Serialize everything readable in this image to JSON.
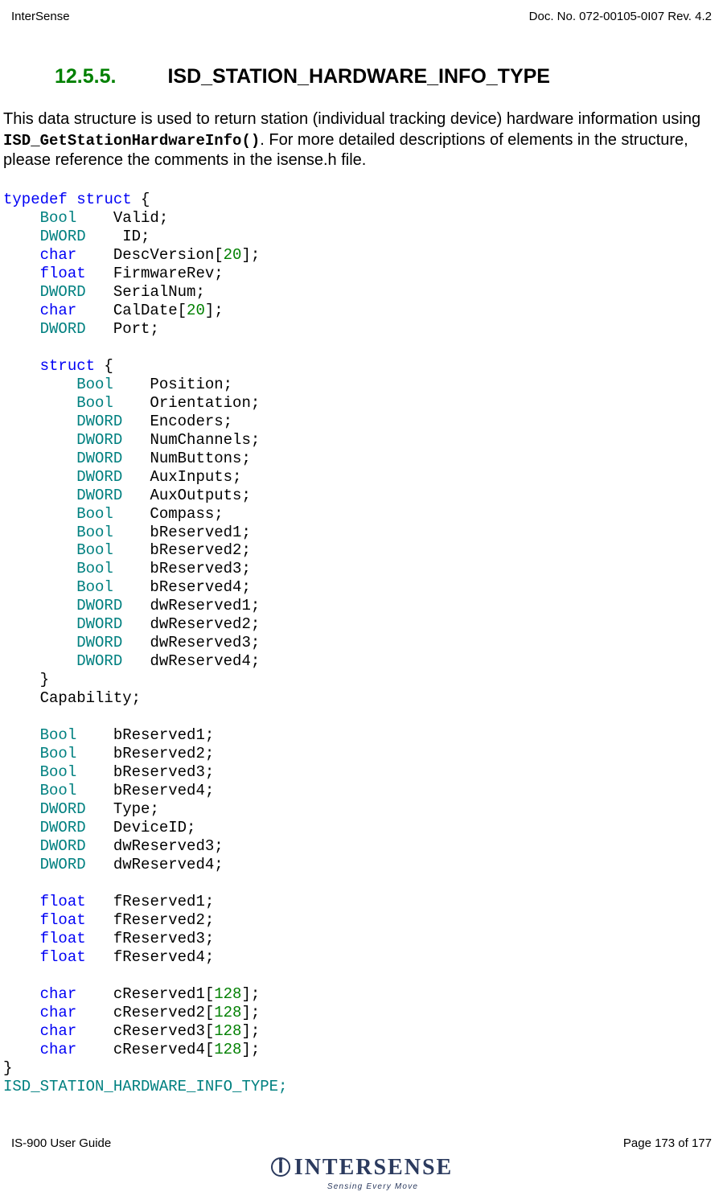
{
  "header": {
    "left": "InterSense",
    "right": "Doc. No. 072-00105-0I07 Rev. 4.2"
  },
  "heading": {
    "number": "12.5.5.",
    "title": "ISD_STATION_HARDWARE_INFO_TYPE"
  },
  "intro": {
    "t1": "This data structure is used to return station (individual tracking device) hardware information using ",
    "fn": "ISD_GetStationHardwareInfo()",
    "t2": ".  For more detailed descriptions of elements in the structure, please reference the comments in the isense.h file."
  },
  "code": {
    "typedef": "typedef",
    "struct": "struct",
    "lbrace": " {",
    "Bool": "Bool",
    "DWORD": "DWORD",
    "char": "char",
    "float": "float",
    "Valid": "    Valid;",
    "ID": "    ID;",
    "DescVersion_a": "    DescVersion[",
    "DescVersion_n": "20",
    "DescVersion_b": "];",
    "FirmwareRev": "   FirmwareRev;",
    "SerialNum": "   SerialNum;",
    "CalDate_a": "    CalDate[",
    "CalDate_n": "20",
    "CalDate_b": "];",
    "Port": "   Port;",
    "inner_struct": "struct",
    "inner_lbrace": " {",
    "cap_Position": "    Position;",
    "cap_Orientation": "    Orientation;",
    "cap_Encoders": "   Encoders;",
    "cap_NumChannels": "   NumChannels;",
    "cap_NumButtons": "   NumButtons;",
    "cap_AuxInputs": "   AuxInputs;",
    "cap_AuxOutputs": "   AuxOutputs;",
    "cap_Compass": "    Compass;",
    "cap_bR1": "    bReserved1;",
    "cap_bR2": "    bReserved2;",
    "cap_bR3": "    bReserved3;",
    "cap_bR4": "    bReserved4;",
    "cap_dwR1": "   dwReserved1;",
    "cap_dwR2": "   dwReserved2;",
    "cap_dwR3": "   dwReserved3;",
    "cap_dwR4": "   dwReserved4;",
    "inner_rbrace": "    }",
    "Capability": "    Capability;",
    "bR1": "    bReserved1;",
    "bR2": "    bReserved2;",
    "bR3": "    bReserved3;",
    "bR4": "    bReserved4;",
    "Type": "   Type;",
    "DeviceID": "   DeviceID;",
    "dwR3": "   dwReserved3;",
    "dwR4": "   dwReserved4;",
    "fR1": "   fReserved1;",
    "fR2": "   fReserved2;",
    "fR3": "   fReserved3;",
    "fR4": "   fReserved4;",
    "cR1a": "    cReserved1[",
    "cR1n": "128",
    "cR1b": "];",
    "cR2a": "    cReserved2[",
    "cR2n": "128",
    "cR2b": "];",
    "cR3a": "    cReserved3[",
    "cR3n": "128",
    "cR3b": "];",
    "cR4a": "    cReserved4[",
    "cR4n": "128",
    "cR4b": "];",
    "rbrace": "}",
    "typedef_name": "ISD_STATION_HARDWARE_INFO_TYPE;"
  },
  "footer": {
    "left": "IS-900 User Guide",
    "right": "Page 173 of 177"
  },
  "logo": {
    "main": "INTERSENSE",
    "sub": "Sensing Every Move"
  }
}
